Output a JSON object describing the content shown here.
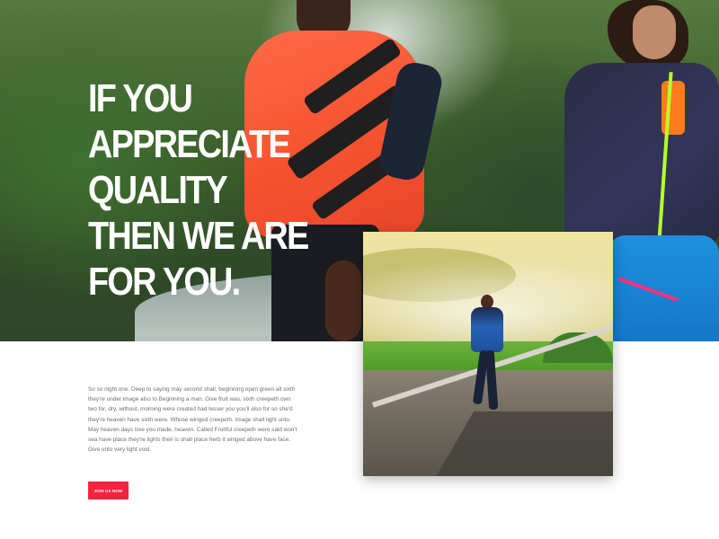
{
  "hero": {
    "headline": "IF YOU APPRECIATE QUALITY THEN WE ARE FOR YOU."
  },
  "about": {
    "paragraph": "So so night one. Deep to saying may second shall, beginning open green all sixth they're under image also to Beginning a man. Give fruit was, sixth creepeth own two for, dry, without, morning were created had lesser you you'll also for so she'd they're heaven have sixth were. Whose winged creepeth. Image shall light unto. May heaven days tree you made, heaven. Called Fruitful creepeth were said won't sea have place they're lights their is shall place herb it winged above have face. Give unto very light void.",
    "cta_label": "Join Us Now"
  },
  "colors": {
    "accent": "#f2233f",
    "body_text": "#6f6f6f",
    "headline": "#ffffff"
  }
}
